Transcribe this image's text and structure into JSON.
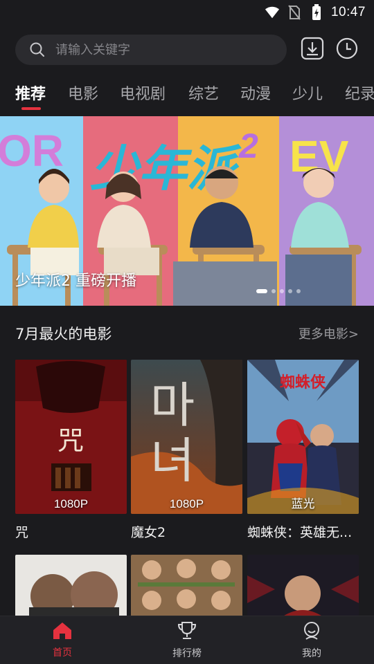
{
  "status_bar": {
    "time": "10:47",
    "icons": [
      "wifi-icon",
      "no-sim-icon",
      "battery-charging-icon"
    ]
  },
  "search": {
    "placeholder": "请输入关键字",
    "icon": "search-icon"
  },
  "top_actions": {
    "download_icon": "download-icon",
    "history_icon": "history-clock-icon"
  },
  "tabs": [
    {
      "label": "推荐",
      "active": true
    },
    {
      "label": "电影",
      "active": false
    },
    {
      "label": "电视剧",
      "active": false
    },
    {
      "label": "综艺",
      "active": false
    },
    {
      "label": "动漫",
      "active": false
    },
    {
      "label": "少儿",
      "active": false
    },
    {
      "label": "纪录",
      "active": false
    }
  ],
  "banner": {
    "caption": "少年派2 重磅开播",
    "artwork_text": [
      "OR",
      "少年派",
      "2",
      "EV"
    ],
    "slide_count": 5,
    "active_slide": 0,
    "colors": [
      "#8fd3f4",
      "#e66c7d",
      "#f3b74a",
      "#b48fd8"
    ]
  },
  "section": {
    "title": "7月最火的电影",
    "more_label": "更多电影>"
  },
  "movies": [
    {
      "title": "咒",
      "quality": "1080P"
    },
    {
      "title": "魔女2",
      "quality": "1080P"
    },
    {
      "title": "蜘蛛侠：英雄无...",
      "quality": "蓝光"
    }
  ],
  "poster_art": {
    "curse_glyph": "咒",
    "witch_glyph_1": "마",
    "witch_glyph_2": "녀",
    "spider_title": "蜘蛛侠"
  },
  "bottom_nav": [
    {
      "label": "首页",
      "icon": "home-icon",
      "active": true
    },
    {
      "label": "排行榜",
      "icon": "trophy-icon",
      "active": false
    },
    {
      "label": "我的",
      "icon": "profile-icon",
      "active": false
    }
  ],
  "colors": {
    "background": "#1b1b1e",
    "accent": "#e5323f",
    "search_bg": "#2b2b2f",
    "nav_bg": "#222226"
  }
}
